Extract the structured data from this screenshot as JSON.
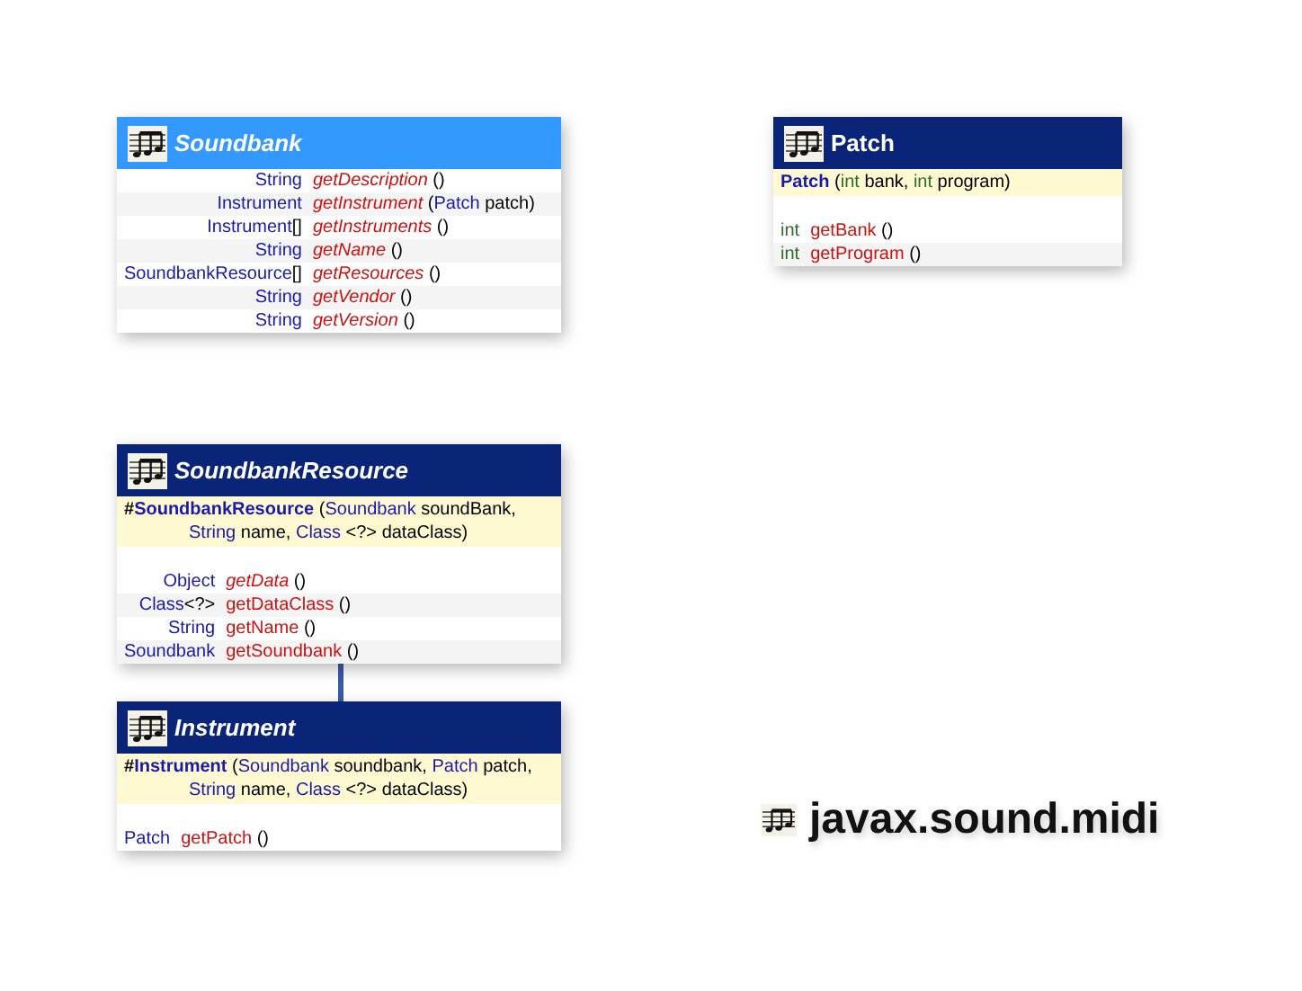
{
  "classes": [
    {
      "name": "Soundbank",
      "kind": "interface",
      "abstract": true,
      "methods": [
        {
          "returns": [
            {
              "text": "String",
              "kind": "type"
            }
          ],
          "name": "getDescription",
          "abstract": true,
          "args": [
            {
              "text": "()",
              "kind": "plain"
            }
          ]
        },
        {
          "returns": [
            {
              "text": "Instrument",
              "kind": "type"
            }
          ],
          "name": "getInstrument",
          "abstract": true,
          "args": [
            {
              "text": "(",
              "kind": "plain"
            },
            {
              "text": "Patch",
              "kind": "type",
              "attached": true
            },
            {
              "text": "patch)",
              "kind": "plain"
            }
          ]
        },
        {
          "returns": [
            {
              "text": "Instrument",
              "kind": "type"
            },
            {
              "text": "[]",
              "kind": "plain",
              "attached": true
            }
          ],
          "name": "getInstruments",
          "abstract": true,
          "args": [
            {
              "text": "()",
              "kind": "plain"
            }
          ]
        },
        {
          "returns": [
            {
              "text": "String",
              "kind": "type"
            }
          ],
          "name": "getName",
          "abstract": true,
          "args": [
            {
              "text": "()",
              "kind": "plain"
            }
          ]
        },
        {
          "returns": [
            {
              "text": "SoundbankResource",
              "kind": "type"
            },
            {
              "text": "[]",
              "kind": "plain",
              "attached": true
            }
          ],
          "name": "getResources",
          "abstract": true,
          "args": [
            {
              "text": "()",
              "kind": "plain"
            }
          ]
        },
        {
          "returns": [
            {
              "text": "String",
              "kind": "type"
            }
          ],
          "name": "getVendor",
          "abstract": true,
          "args": [
            {
              "text": "()",
              "kind": "plain"
            }
          ]
        },
        {
          "returns": [
            {
              "text": "String",
              "kind": "type"
            }
          ],
          "name": "getVersion",
          "abstract": true,
          "args": [
            {
              "text": "()",
              "kind": "plain"
            }
          ]
        }
      ]
    },
    {
      "name": "Patch",
      "kind": "class",
      "abstract": false,
      "constructors": [
        {
          "name": "Patch",
          "args": [
            {
              "text": "(",
              "kind": "plain"
            },
            {
              "text": "int",
              "kind": "primitive",
              "attached": true
            },
            {
              "text": "bank,",
              "kind": "plain"
            },
            {
              "text": "int",
              "kind": "primitive"
            },
            {
              "text": "program)",
              "kind": "plain"
            }
          ]
        }
      ],
      "methods": [
        {
          "returns": [
            {
              "text": "int",
              "kind": "primitive"
            }
          ],
          "name": "getBank",
          "abstract": false,
          "args": [
            {
              "text": "()",
              "kind": "plain"
            }
          ]
        },
        {
          "returns": [
            {
              "text": "int",
              "kind": "primitive"
            }
          ],
          "name": "getProgram",
          "abstract": false,
          "args": [
            {
              "text": "()",
              "kind": "plain"
            }
          ]
        }
      ]
    },
    {
      "name": "SoundbankResource",
      "kind": "class",
      "abstract": true,
      "constructors": [
        {
          "visibility": "#",
          "name": "SoundbankResource",
          "args": [
            {
              "text": "(",
              "kind": "plain"
            },
            {
              "text": "Soundbank",
              "kind": "type",
              "attached": true
            },
            {
              "text": "soundBank,",
              "kind": "plain"
            },
            {
              "text": "String",
              "kind": "type"
            },
            {
              "text": "name,",
              "kind": "plain"
            },
            {
              "text": "Class",
              "kind": "type"
            },
            {
              "text": "<?>",
              "kind": "plain"
            },
            {
              "text": "dataClass)",
              "kind": "plain"
            }
          ]
        }
      ],
      "methods": [
        {
          "returns": [
            {
              "text": "Object",
              "kind": "type"
            }
          ],
          "name": "getData",
          "abstract": true,
          "args": [
            {
              "text": "()",
              "kind": "plain"
            }
          ]
        },
        {
          "returns": [
            {
              "text": "Class",
              "kind": "type"
            },
            {
              "text": "<?>",
              "kind": "plain",
              "attached": true
            }
          ],
          "name": "getDataClass",
          "abstract": false,
          "args": [
            {
              "text": "()",
              "kind": "plain"
            }
          ]
        },
        {
          "returns": [
            {
              "text": "String",
              "kind": "type"
            }
          ],
          "name": "getName",
          "abstract": false,
          "args": [
            {
              "text": "()",
              "kind": "plain"
            }
          ]
        },
        {
          "returns": [
            {
              "text": "Soundbank",
              "kind": "type"
            }
          ],
          "name": "getSoundbank",
          "abstract": false,
          "args": [
            {
              "text": "()",
              "kind": "plain"
            }
          ]
        }
      ]
    },
    {
      "name": "Instrument",
      "kind": "class",
      "abstract": true,
      "constructors": [
        {
          "visibility": "#",
          "name": "Instrument",
          "args": [
            {
              "text": "(",
              "kind": "plain"
            },
            {
              "text": "Soundbank",
              "kind": "type",
              "attached": true
            },
            {
              "text": "soundbank,",
              "kind": "plain"
            },
            {
              "text": "Patch",
              "kind": "type"
            },
            {
              "text": "patch,",
              "kind": "plain"
            },
            {
              "text": "String",
              "kind": "type"
            },
            {
              "text": "name,",
              "kind": "plain"
            },
            {
              "text": "Class",
              "kind": "type"
            },
            {
              "text": "<?>",
              "kind": "plain"
            },
            {
              "text": "dataClass)",
              "kind": "plain"
            }
          ]
        }
      ],
      "methods": [
        {
          "returns": [
            {
              "text": "Patch",
              "kind": "type"
            }
          ],
          "name": "getPatch",
          "abstract": false,
          "args": [
            {
              "text": "()",
              "kind": "plain"
            }
          ]
        }
      ]
    }
  ],
  "package": "javax.sound.midi"
}
